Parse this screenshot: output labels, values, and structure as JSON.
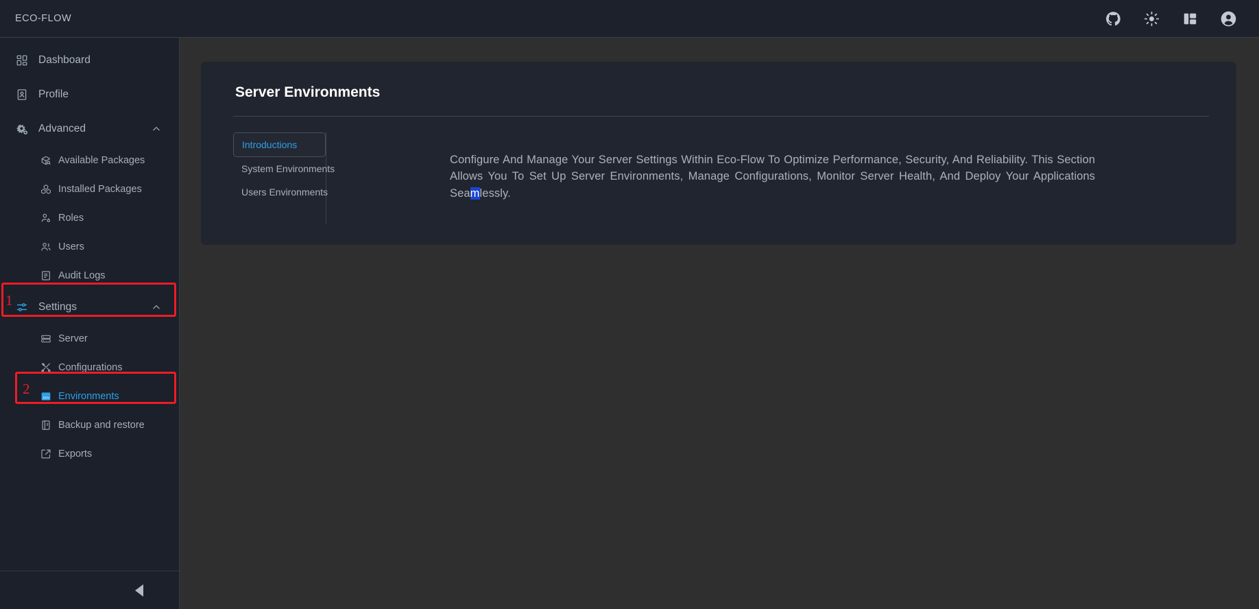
{
  "topbar": {
    "brand": "ECO-FLOW",
    "actions": [
      {
        "name": "github-icon",
        "label": "GitHub"
      },
      {
        "name": "sun-icon",
        "label": "Toggle theme"
      },
      {
        "name": "layout-panel-icon",
        "label": "Toggle layout"
      },
      {
        "name": "user-avatar-icon",
        "label": "Account"
      }
    ]
  },
  "sidebar": {
    "items": [
      {
        "label": "Dashboard",
        "icon": "dashboard-grid-icon",
        "level": "top"
      },
      {
        "label": "Profile",
        "icon": "profile-card-icon",
        "level": "top"
      },
      {
        "label": "Advanced",
        "icon": "gears-icon",
        "level": "top",
        "expanded": true,
        "chevron": "chevron-up-icon"
      },
      {
        "label": "Available Packages",
        "icon": "package-search-icon",
        "level": "sub"
      },
      {
        "label": "Installed Packages",
        "icon": "packages-stack-icon",
        "level": "sub"
      },
      {
        "label": "Roles",
        "icon": "user-key-icon",
        "level": "sub"
      },
      {
        "label": "Users",
        "icon": "users-icon",
        "level": "sub"
      },
      {
        "label": "Audit Logs",
        "icon": "audit-log-icon",
        "level": "sub"
      },
      {
        "label": "Settings",
        "icon": "sliders-icon",
        "level": "top",
        "expanded": true,
        "chevron": "chevron-up-icon",
        "accent_icon": true
      },
      {
        "label": "Server",
        "icon": "server-rack-icon",
        "level": "sub"
      },
      {
        "label": "Configurations",
        "icon": "tools-icon",
        "level": "sub"
      },
      {
        "label": "Environments",
        "icon": "env-file-icon",
        "level": "sub",
        "active": true
      },
      {
        "label": "Backup and restore",
        "icon": "backup-archive-icon",
        "level": "sub"
      },
      {
        "label": "Exports",
        "icon": "export-share-icon",
        "level": "sub"
      }
    ],
    "collapse_label": "Collapse sidebar"
  },
  "annotations": [
    {
      "number": "1",
      "target": "Settings"
    },
    {
      "number": "2",
      "target": "Environments"
    }
  ],
  "main": {
    "card_title": "Server Environments",
    "tabs": [
      {
        "label": "Introductions",
        "active": true
      },
      {
        "label": "System Environments",
        "active": false
      },
      {
        "label": "Users Environments",
        "active": false
      }
    ],
    "body": {
      "text_before": "Configure And Manage Your Server Settings Within Eco-Flow To Optimize Performance, Security, And Reliability. This Section Allows You To Set Up Server Environments, Manage Configurations, Monitor Server Health, And Deploy Your Applications Sea",
      "text_selected": "m",
      "text_after": "lessly."
    }
  },
  "colors": {
    "accent_blue": "#2f9fe8",
    "annotation_red": "#ee1c25",
    "selection_blue": "#1a44d0",
    "sidebar_bg": "#1b202a",
    "card_bg": "#21252f",
    "main_bg": "#2f2f2f"
  }
}
